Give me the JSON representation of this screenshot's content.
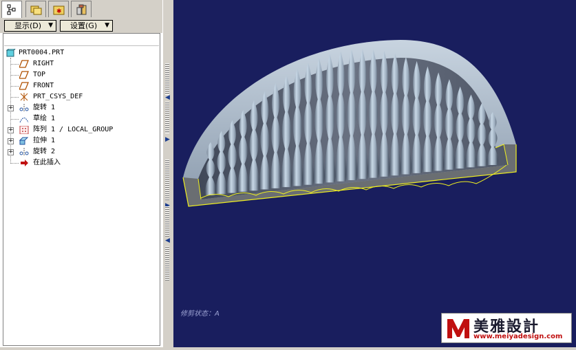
{
  "tabs": [
    {
      "icon": "model-tree-icon"
    },
    {
      "icon": "folder-browser-icon"
    },
    {
      "icon": "favorites-folder-icon"
    },
    {
      "icon": "connections-icon"
    }
  ],
  "toolbar": {
    "display_label": "显示(D)",
    "settings_label": "设置(G)"
  },
  "tree": {
    "root": "PRT0004.PRT",
    "items": [
      {
        "label": "RIGHT",
        "icon": "datum-plane-icon",
        "expandable": false
      },
      {
        "label": "TOP",
        "icon": "datum-plane-icon",
        "expandable": false
      },
      {
        "label": "FRONT",
        "icon": "datum-plane-icon",
        "expandable": false
      },
      {
        "label": "PRT_CSYS_DEF",
        "icon": "coordinate-system-icon",
        "expandable": false
      },
      {
        "label": "旋转 1",
        "icon": "revolve-icon",
        "expandable": true
      },
      {
        "label": "草绘 1",
        "icon": "sketch-icon",
        "expandable": false
      },
      {
        "label": "阵列 1 / LOCAL_GROUP",
        "icon": "pattern-icon",
        "expandable": true
      },
      {
        "label": "拉伸 1",
        "icon": "extrude-icon",
        "expandable": true
      },
      {
        "label": "旋转 2",
        "icon": "revolve-icon",
        "expandable": true
      },
      {
        "label": "在此插入",
        "icon": "insert-here-arrow-icon",
        "expandable": false
      }
    ]
  },
  "viewport": {
    "background": "#191e5e",
    "status_text": "修剪状态：A"
  },
  "watermark": {
    "chinese": "美雅設計",
    "url": "www.meiyadesign.com"
  }
}
